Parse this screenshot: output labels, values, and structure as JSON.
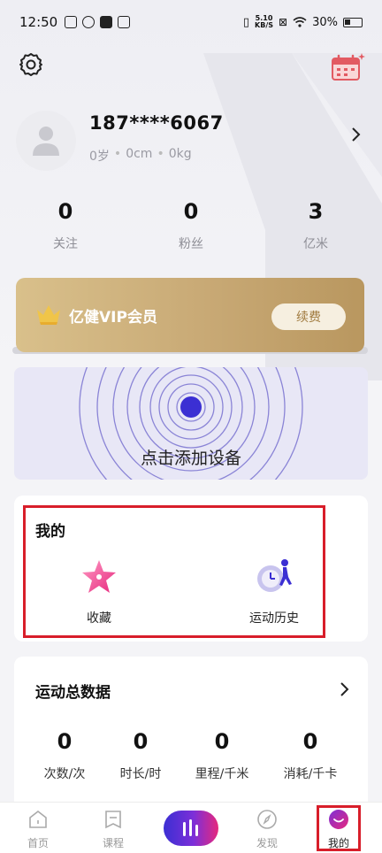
{
  "status_bar": {
    "time": "12:50",
    "net_speed_top": "5.10",
    "net_speed_unit": "KB/S",
    "battery": "30%"
  },
  "profile": {
    "username": "187****6067",
    "age": "0岁",
    "height": "0cm",
    "weight": "0kg"
  },
  "stats": [
    {
      "value": "0",
      "label": "关注"
    },
    {
      "value": "0",
      "label": "粉丝"
    },
    {
      "value": "3",
      "label": "亿米"
    }
  ],
  "vip": {
    "title": "亿健VIP会员",
    "renew_label": "续费"
  },
  "device": {
    "label": "点击添加设备"
  },
  "my": {
    "title": "我的",
    "items": [
      {
        "label": "收藏",
        "icon": "star-icon"
      },
      {
        "label": "运动历史",
        "icon": "runner-clock-icon"
      }
    ]
  },
  "sport": {
    "title": "运动总数据",
    "items": [
      {
        "value": "0",
        "label": "次数/次"
      },
      {
        "value": "0",
        "label": "时长/时"
      },
      {
        "value": "0",
        "label": "里程/千米"
      },
      {
        "value": "0",
        "label": "消耗/千卡"
      }
    ]
  },
  "tabs": [
    {
      "label": "首页",
      "icon": "home-icon"
    },
    {
      "label": "课程",
      "icon": "course-icon"
    },
    {
      "label": "",
      "icon": "sport-bars-icon"
    },
    {
      "label": "发现",
      "icon": "compass-icon"
    },
    {
      "label": "我的",
      "icon": "profile-face-icon"
    }
  ],
  "colors": {
    "accent": "#3b2fd3",
    "highlight": "#d81e2a",
    "vip_gold": "#c8a975"
  }
}
